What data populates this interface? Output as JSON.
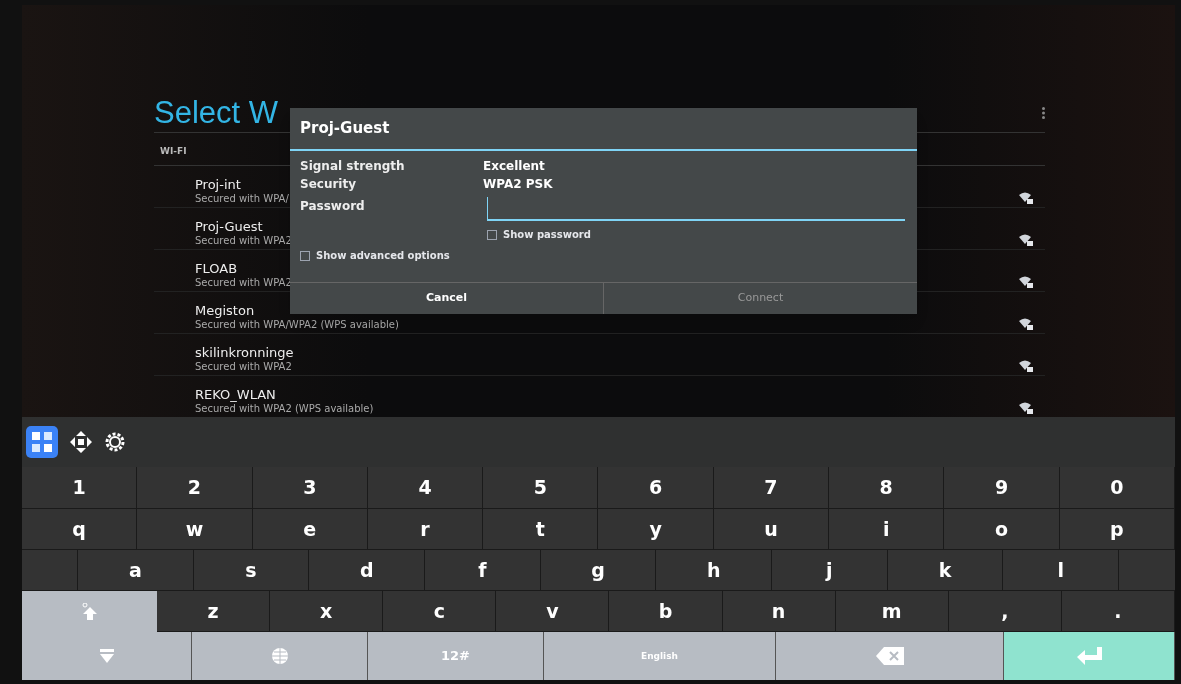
{
  "screen": {
    "title": "Select W",
    "section_label": "WI-FI"
  },
  "networks": [
    {
      "name": "Proj-int",
      "status": "Secured with WPA/"
    },
    {
      "name": "Proj-Guest",
      "status": "Secured with WPA2"
    },
    {
      "name": "FLOAB",
      "status": "Secured with WPA2"
    },
    {
      "name": "Megiston",
      "status": "Secured with WPA/WPA2 (WPS available)"
    },
    {
      "name": "skilinkronninge",
      "status": "Secured with WPA2"
    },
    {
      "name": "REKO_WLAN",
      "status": "Secured with WPA2 (WPS available)"
    }
  ],
  "dialog": {
    "title": "Proj-Guest",
    "details": [
      {
        "label": "Signal strength",
        "value": "Excellent"
      },
      {
        "label": "Security",
        "value": "WPA2 PSK"
      }
    ],
    "password": {
      "label": "Password"
    },
    "show_password": {
      "label": "Show password",
      "checked": false
    },
    "show_advanced": {
      "label": "Show advanced options",
      "checked": false
    },
    "buttons": [
      {
        "label": "Cancel",
        "disabled": false
      },
      {
        "label": "Connect",
        "disabled": true
      }
    ]
  },
  "keyboard": {
    "rows": [
      {
        "keys": [
          "1",
          "2",
          "3",
          "4",
          "5",
          "6",
          "7",
          "8",
          "9",
          "0"
        ]
      },
      {
        "keys": [
          "q",
          "w",
          "e",
          "r",
          "t",
          "y",
          "u",
          "i",
          "o",
          "p"
        ]
      },
      {
        "keys": [
          "a",
          "s",
          "d",
          "f",
          "g",
          "h",
          "j",
          "k",
          "l"
        ]
      },
      {
        "keys": [
          "z",
          "x",
          "c",
          "v",
          "b",
          "n",
          "m",
          ",",
          "."
        ]
      }
    ],
    "function_keys": [
      {
        "kind": "hide"
      },
      {
        "kind": "globe"
      },
      {
        "kind": "text",
        "label": "12#"
      },
      {
        "kind": "language",
        "label": "English"
      },
      {
        "kind": "backspace"
      },
      {
        "kind": "enter"
      }
    ]
  }
}
